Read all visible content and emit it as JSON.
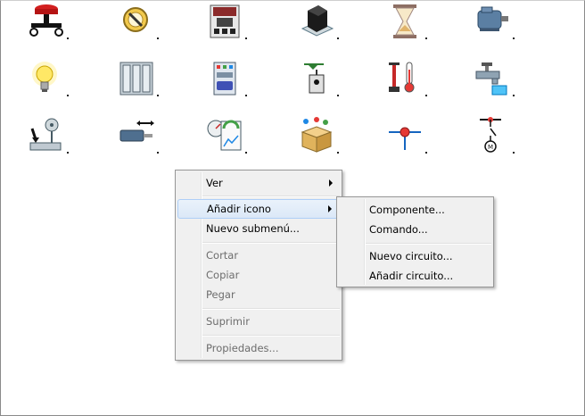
{
  "icons": [
    {
      "name": "emergency-stop-button-icon"
    },
    {
      "name": "fuse-icon"
    },
    {
      "name": "contactor-icon"
    },
    {
      "name": "switch-block-icon"
    },
    {
      "name": "hourglass-icon"
    },
    {
      "name": "electric-motor-icon"
    },
    {
      "name": "light-bulb-icon"
    },
    {
      "name": "plc-rack-icon"
    },
    {
      "name": "io-module-icon"
    },
    {
      "name": "limit-switch-icon"
    },
    {
      "name": "thermometer-pump-icon"
    },
    {
      "name": "water-tap-icon"
    },
    {
      "name": "sensor-antenna-icon"
    },
    {
      "name": "linear-actuator-icon"
    },
    {
      "name": "gauges-chart-icon"
    },
    {
      "name": "package-box-icon"
    },
    {
      "name": "junction-node-icon"
    },
    {
      "name": "motor-circuit-icon"
    }
  ],
  "context_menu": {
    "items": [
      {
        "label": "Ver",
        "submenu": true,
        "disabled": false
      },
      {
        "label": "Añadir icono",
        "submenu": true,
        "disabled": false,
        "highlighted": true
      },
      {
        "label": "Nuevo submenú...",
        "disabled": false
      },
      {
        "label": "Cortar",
        "disabled": true
      },
      {
        "label": "Copiar",
        "disabled": true
      },
      {
        "label": "Pegar",
        "disabled": true
      },
      {
        "label": "Suprimir",
        "disabled": true
      },
      {
        "label": "Propiedades...",
        "disabled": true
      }
    ]
  },
  "submenu": {
    "items": [
      {
        "label": "Componente..."
      },
      {
        "label": "Comando..."
      },
      {
        "label": "Nuevo circuito..."
      },
      {
        "label": "Añadir circuito..."
      }
    ]
  },
  "colors": {
    "menu_bg": "#f0f0f0",
    "menu_border": "#979797",
    "highlight_bg": "#dbe8f7",
    "highlight_border": "#aecff7",
    "disabled_text": "#6d6d6d"
  }
}
